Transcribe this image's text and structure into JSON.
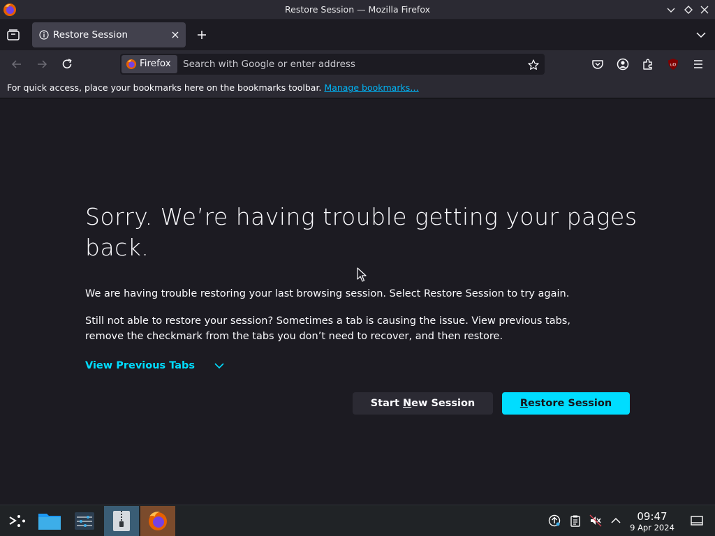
{
  "window": {
    "title": "Restore Session — Mozilla Firefox"
  },
  "tabs": [
    {
      "label": "Restore Session"
    }
  ],
  "navbar": {
    "identity_label": "Firefox",
    "search_placeholder": "Search with Google or enter address"
  },
  "bookmarks_bar": {
    "hint": "For quick access, place your bookmarks here on the bookmarks toolbar.",
    "manage_link": "Manage bookmarks…"
  },
  "page": {
    "heading": "Sorry. We’re having trouble getting your pages back.",
    "paragraph1": "We are having trouble restoring your last browsing session. Select Restore Session to try again.",
    "paragraph2": "Still not able to restore your session? Sometimes a tab is causing the issue. View previous tabs, remove the checkmark from the tabs you don’t need to recover, and then restore.",
    "view_previous_tabs": "View Previous Tabs",
    "start_new_session": {
      "before": "Start ",
      "accesskey": "N",
      "after": "ew Session"
    },
    "restore_session": {
      "before": "",
      "accesskey": "R",
      "after": "estore Session"
    }
  },
  "taskbar": {
    "time": "09:47",
    "date": "9 Apr 2024"
  },
  "colors": {
    "accent": "#00ddff",
    "background": "#1c1b22",
    "toolbar": "#2b2a33",
    "link": "#00b3f4"
  }
}
